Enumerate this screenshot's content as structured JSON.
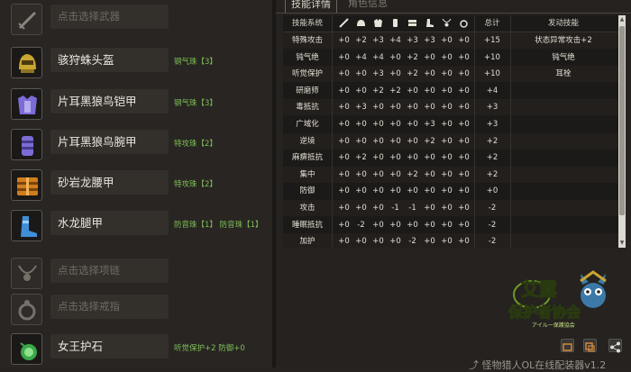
{
  "equipment": [
    {
      "name": "点击选择武器",
      "empty": true,
      "decos": ""
    },
    {
      "name": "骇狩蛛头盔",
      "empty": false,
      "decos": "钢气珠【3】"
    },
    {
      "name": "片耳黑狼鸟铠甲",
      "empty": false,
      "decos": "钢气珠【3】"
    },
    {
      "name": "片耳黑狼鸟腕甲",
      "empty": false,
      "decos": "特攻珠【2】"
    },
    {
      "name": "砂岩龙腰甲",
      "empty": false,
      "decos": "特攻珠【2】"
    },
    {
      "name": "水龙腿甲",
      "empty": false,
      "decos": "防音珠【1】 防音珠【1】"
    },
    {
      "name": "点击选择项链",
      "empty": true,
      "decos": ""
    },
    {
      "name": "点击选择戒指",
      "empty": true,
      "decos": ""
    },
    {
      "name": "女王护石",
      "empty": false,
      "decos": "听觉保护+2 防御+0"
    }
  ],
  "tabs": {
    "active": "技能详情",
    "inactive": "角色信息"
  },
  "skill_table": {
    "headers": {
      "system": "技能系统",
      "total": "总计",
      "activated": "发动技能"
    },
    "slot_icons": [
      "weapon-icon",
      "head-icon",
      "chest-icon",
      "arms-icon",
      "waist-icon",
      "legs-icon",
      "necklace-icon",
      "ring-icon",
      "charm-icon"
    ],
    "rows": [
      {
        "name": "特殊攻击",
        "values": [
          "+0",
          "+2",
          "+3",
          "+4",
          "+3",
          "+3",
          "+0",
          "+0"
        ],
        "total": "+15",
        "skill": "状态异常攻击+2"
      },
      {
        "name": "钝气绝",
        "values": [
          "+0",
          "+4",
          "+4",
          "+0",
          "+2",
          "+0",
          "+0",
          "+0"
        ],
        "total": "+10",
        "skill": "钝气绝"
      },
      {
        "name": "听觉保护",
        "values": [
          "+0",
          "+0",
          "+3",
          "+0",
          "+2",
          "+0",
          "+0",
          "+0"
        ],
        "total": "+10",
        "skill": "耳栓"
      },
      {
        "name": "研磨师",
        "values": [
          "+0",
          "+0",
          "+2",
          "+2",
          "+0",
          "+0",
          "+0",
          "+0"
        ],
        "total": "+4",
        "skill": ""
      },
      {
        "name": "毒抵抗",
        "values": [
          "+0",
          "+3",
          "+0",
          "+0",
          "+0",
          "+0",
          "+0",
          "+0"
        ],
        "total": "+3",
        "skill": ""
      },
      {
        "name": "广域化",
        "values": [
          "+0",
          "+0",
          "+0",
          "+0",
          "+0",
          "+3",
          "+0",
          "+0"
        ],
        "total": "+3",
        "skill": ""
      },
      {
        "name": "逆境",
        "values": [
          "+0",
          "+0",
          "+0",
          "+0",
          "+0",
          "+2",
          "+0",
          "+0"
        ],
        "total": "+2",
        "skill": ""
      },
      {
        "name": "麻痹抵抗",
        "values": [
          "+0",
          "+2",
          "+0",
          "+0",
          "+0",
          "+0",
          "+0",
          "+0"
        ],
        "total": "+2",
        "skill": ""
      },
      {
        "name": "集中",
        "values": [
          "+0",
          "+0",
          "+0",
          "+0",
          "+2",
          "+0",
          "+0",
          "+0"
        ],
        "total": "+2",
        "skill": ""
      },
      {
        "name": "防御",
        "values": [
          "+0",
          "+0",
          "+0",
          "+0",
          "+0",
          "+0",
          "+0",
          "+0"
        ],
        "total": "+0",
        "skill": ""
      },
      {
        "name": "攻击",
        "values": [
          "+0",
          "+0",
          "+0",
          "-1",
          "-1",
          "+0",
          "+0",
          "+0"
        ],
        "total": "-2",
        "skill": ""
      },
      {
        "name": "睡眠抵抗",
        "values": [
          "+0",
          "-2",
          "+0",
          "+0",
          "+0",
          "+0",
          "+0",
          "+0"
        ],
        "total": "-2",
        "skill": ""
      },
      {
        "name": "加护",
        "values": [
          "+0",
          "+0",
          "+0",
          "+0",
          "-2",
          "+0",
          "+0",
          "+0"
        ],
        "total": "-2",
        "skill": ""
      }
    ]
  },
  "logo": {
    "line1": "艾露",
    "line2": "保护者协会",
    "sub": "アイルー保護協会"
  },
  "footer": "怪物猎人OL在线配装器v1.2",
  "colors": {
    "accent_green": "#7fbf58",
    "logo_green": "#b7e34a",
    "background": "#262320"
  }
}
